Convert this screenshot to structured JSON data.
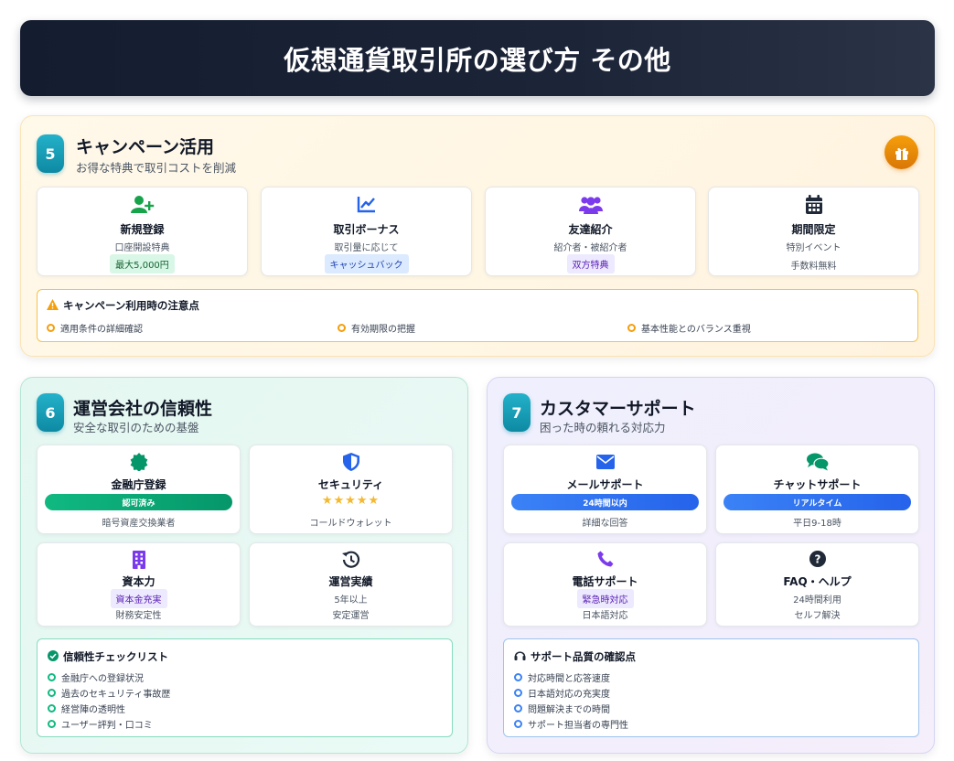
{
  "header": {
    "title": "仮想通貨取引所の選び方 その他"
  },
  "section5": {
    "number": "5",
    "title": "キャンペーン活用",
    "subtitle": "お得な特典で取引コストを削減",
    "cards": [
      {
        "icon": "user-plus-icon",
        "title": "新規登録",
        "sub": "口座開設特典",
        "tag": "最大5,000円",
        "tag_color": "#16a34a"
      },
      {
        "icon": "chart-line-icon",
        "title": "取引ボーナス",
        "sub": "取引量に応じて",
        "tag": "キャッシュバック",
        "tag_color": "#2563eb"
      },
      {
        "icon": "users-icon",
        "title": "友達紹介",
        "sub": "紹介者・被紹介者",
        "tag": "双方特典",
        "tag_color": "#7c3aed"
      },
      {
        "icon": "calendar-icon",
        "title": "期間限定",
        "sub": "特別イベント",
        "tag": "手数料無料"
      }
    ],
    "notice": {
      "title": "キャンペーン利用時の注意点",
      "items": [
        "適用条件の詳細確認",
        "有効期限の把握",
        "基本性能とのバランス重視"
      ]
    }
  },
  "section6": {
    "number": "6",
    "title": "運営会社の信頼性",
    "subtitle": "安全な取引のための基盤",
    "cards": [
      {
        "icon": "certificate-icon",
        "title": "金融庁登録",
        "pill": "認可済み",
        "sub": "暗号資産交換業者"
      },
      {
        "icon": "shield-icon",
        "title": "セキュリティ",
        "stars": "★★★★★",
        "sub": "コールドウォレット"
      },
      {
        "icon": "building-icon",
        "title": "資本力",
        "tag": "資本金充実",
        "sub": "財務安定性"
      },
      {
        "icon": "history-icon",
        "title": "運営実績",
        "line1": "5年以上",
        "sub": "安定運営"
      }
    ],
    "checklist": {
      "title": "信頼性チェックリスト",
      "items": [
        "金融庁への登録状況",
        "過去のセキュリティ事故歴",
        "経営陣の透明性",
        "ユーザー評判・口コミ"
      ]
    }
  },
  "section7": {
    "number": "7",
    "title": "カスタマーサポート",
    "subtitle": "困った時の頼れる対応力",
    "cards": [
      {
        "icon": "envelope-icon",
        "title": "メールサポート",
        "pill": "24時間以内",
        "sub": "詳細な回答"
      },
      {
        "icon": "chat-icon",
        "title": "チャットサポート",
        "pill": "リアルタイム",
        "sub": "平日9-18時"
      },
      {
        "icon": "phone-icon",
        "title": "電話サポート",
        "tag": "緊急時対応",
        "sub": "日本語対応"
      },
      {
        "icon": "question-icon",
        "title": "FAQ・ヘルプ",
        "line1": "24時間利用",
        "sub": "セルフ解決"
      }
    ],
    "checklist": {
      "title": "サポート品質の確認点",
      "items": [
        "対応時間と応答速度",
        "日本語対応の充実度",
        "問題解決までの時間",
        "サポート担当者の専門性"
      ]
    }
  },
  "colors": {
    "header_bg": "#141d30",
    "accent_teal": "#0e8aa3",
    "amber": "#f59e0b",
    "green": "#10b981",
    "blue": "#3b82f6",
    "purple": "#7c3aed"
  }
}
